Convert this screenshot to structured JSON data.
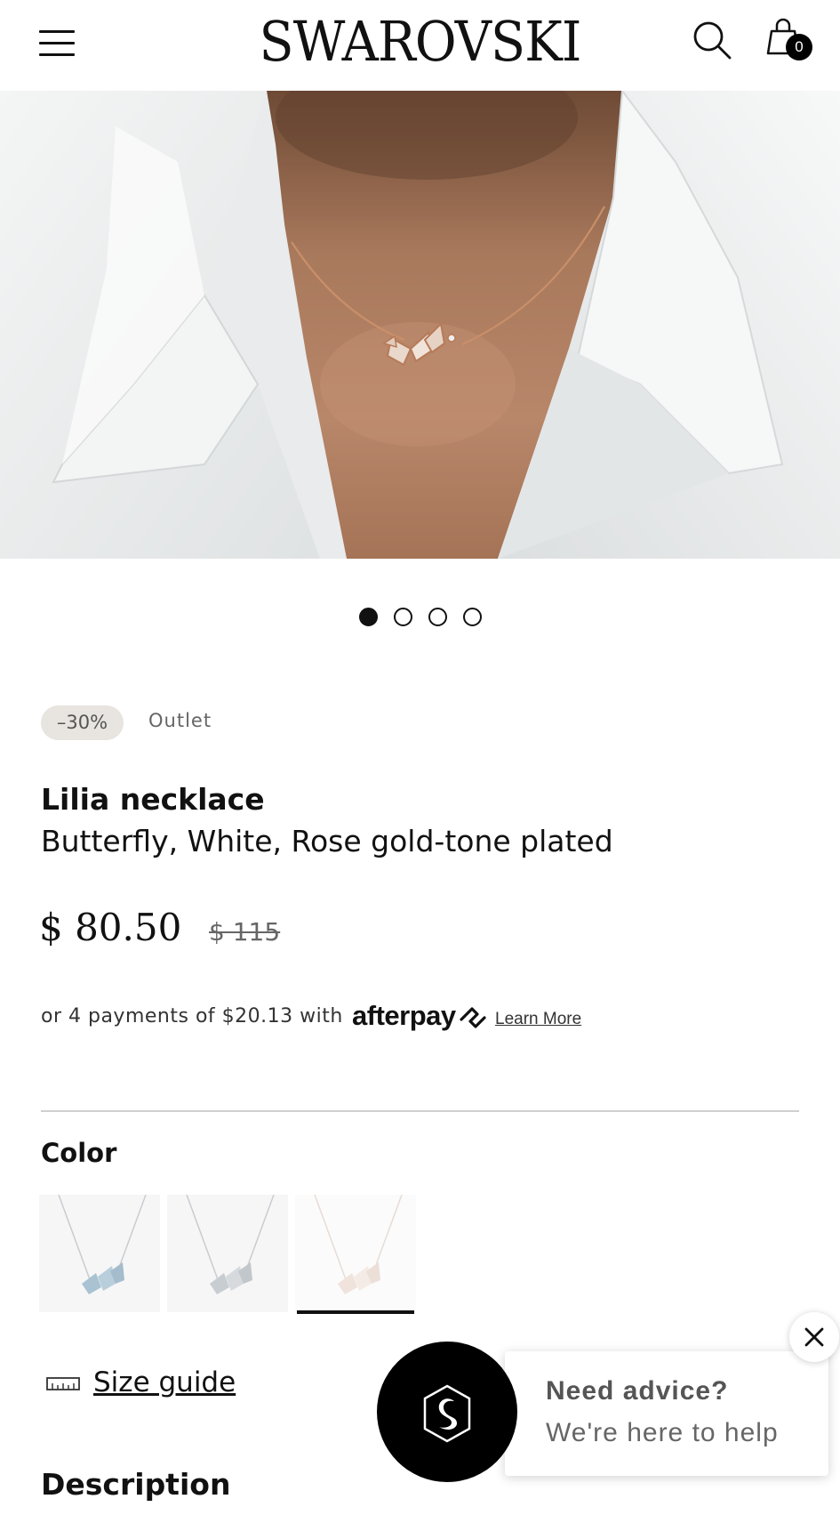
{
  "header": {
    "logo": "SWAROVSKI",
    "cart_count": "0"
  },
  "carousel": {
    "slides": 4,
    "active_index": 0
  },
  "product": {
    "discount_badge": "–30%",
    "tag": "Outlet",
    "title": "Lilia necklace",
    "subtitle": "Butterfly, White, Rose gold-tone plated",
    "price": "$ 80.50",
    "original_price": "$ 115",
    "installments_text": "or 4 payments of $20.13 with",
    "afterpay_brand": "afterpay",
    "learn_more": "Learn More"
  },
  "color": {
    "label": "Color",
    "selected_index": 2,
    "swatches": [
      "blue-tone",
      "silver-tone",
      "rose-gold-tone"
    ]
  },
  "size_guide": {
    "label": "Size guide"
  },
  "description": {
    "heading": "Description"
  },
  "chat": {
    "title": "Need advice?",
    "subtitle": "We're here to help"
  },
  "colors": {
    "primary": "#111111",
    "discount_badge_bg": "#e8e4df",
    "chat_bubble": "#000000"
  },
  "icons": [
    "hamburger-menu-icon",
    "search-icon",
    "bag-icon",
    "afterpay-icon",
    "ruler-icon",
    "swan-icon",
    "close-icon"
  ]
}
